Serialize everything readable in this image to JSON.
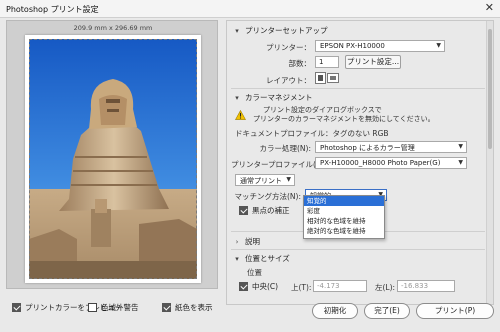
{
  "window": {
    "title": "Photoshop プリント設定",
    "close_glyph": "✕"
  },
  "preview": {
    "paper_size": "209.9 mm x 296.69 mm"
  },
  "bottom_options": [
    {
      "label": "プリントカラーをプレビュー",
      "checked": true
    },
    {
      "label": "色域外警告",
      "checked": false
    },
    {
      "label": "紙色を表示",
      "checked": true
    }
  ],
  "printer_setup": {
    "title": "プリンターセットアップ",
    "printer_label": "プリンター：",
    "printer_value": "EPSON PX-H10000",
    "copies_label": "部数：",
    "copies_value": "1",
    "print_settings_button": "プリント設定...",
    "layout_label": "レイアウト："
  },
  "color_management": {
    "title": "カラーマネジメント",
    "warning_line1": "プリント設定のダイアログボックスで",
    "warning_line2": "プリンターのカラーマネジメントを無効にしてください。",
    "doc_profile": "ドキュメントプロファイル：タグのない RGB",
    "color_handling_label": "カラー処理(N):",
    "color_handling_value": "Photoshop によるカラー管理",
    "printer_profile_label": "プリンタープロファイル(F):",
    "printer_profile_value": "PX-H10000_H8000 Photo Paper(G)",
    "print_mode_value": "通常プリント",
    "rendering_label": "マッチング方法(N):",
    "rendering_value": "知覚的",
    "bpc_label": "黒点の補正",
    "bpc_checked": true,
    "rendering_options": [
      "知覚的",
      "彩度",
      "相対的な色域を維持",
      "絶対的な色域を維持"
    ],
    "rendering_selected_index": 0
  },
  "description": {
    "title": "説明"
  },
  "position_size": {
    "title": "位置とサイズ",
    "position_title": "位置",
    "center_label": "中央(C)",
    "center_checked": true,
    "top_label": "上(T):",
    "top_value": "-4.173",
    "left_label": "左(L):",
    "left_value": "-16.833"
  },
  "footer": {
    "reset": "初期化",
    "done": "完了(E)",
    "print": "プリント(P)"
  }
}
